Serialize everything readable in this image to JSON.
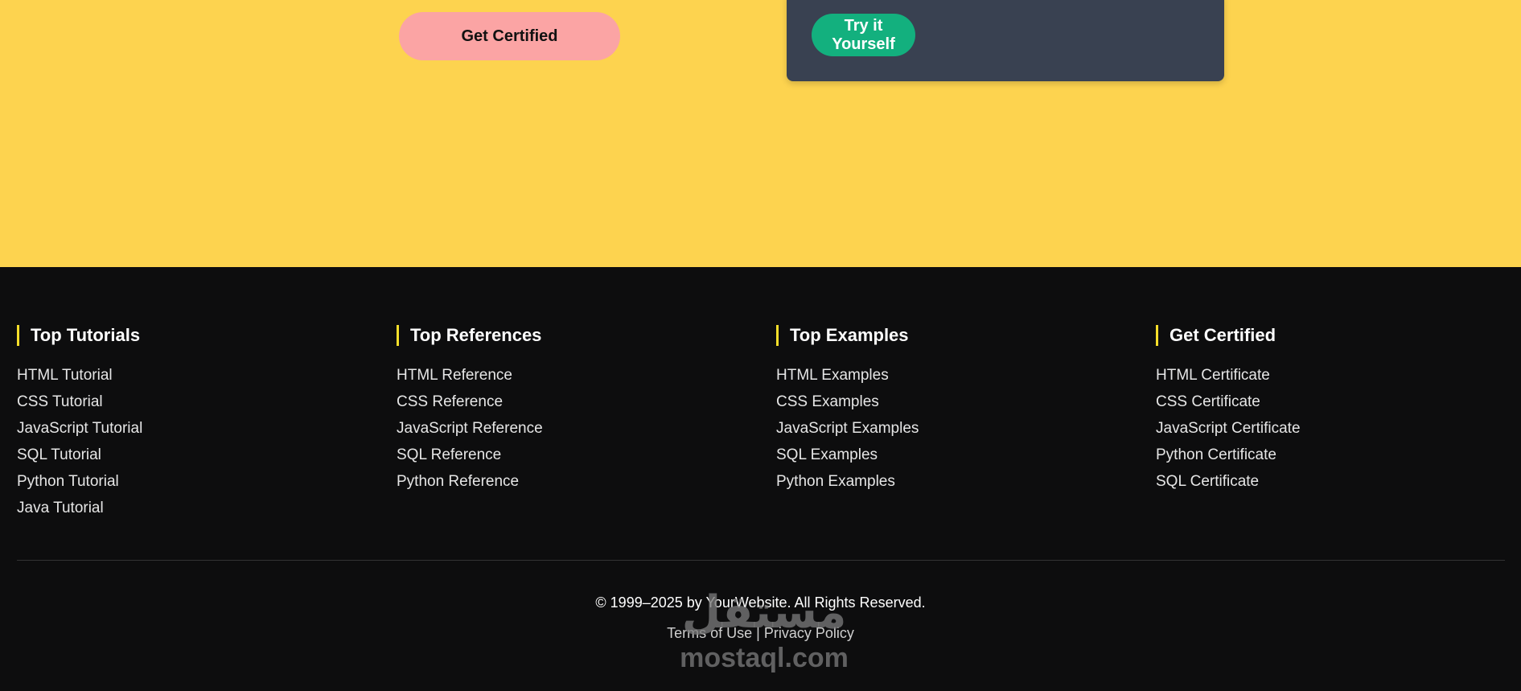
{
  "hero": {
    "background": "#fdd34f",
    "get_certified_label": "Get Certified",
    "try_it_label": "Try it Yourself"
  },
  "footer": {
    "columns": [
      {
        "title": "Top Tutorials",
        "links": [
          "HTML Tutorial",
          "CSS Tutorial",
          "JavaScript Tutorial",
          "SQL Tutorial",
          "Python Tutorial",
          "Java Tutorial"
        ]
      },
      {
        "title": "Top References",
        "links": [
          "HTML Reference",
          "CSS Reference",
          "JavaScript Reference",
          "SQL Reference",
          "Python Reference"
        ]
      },
      {
        "title": "Top Examples",
        "links": [
          "HTML Examples",
          "CSS Examples",
          "JavaScript Examples",
          "SQL Examples",
          "Python Examples"
        ]
      },
      {
        "title": "Get Certified",
        "links": [
          "HTML Certificate",
          "CSS Certificate",
          "JavaScript Certificate",
          "Python Certificate",
          "SQL Certificate"
        ]
      }
    ],
    "copyright": "© 1999–2025 by YourWebsite. All Rights Reserved.",
    "terms_label": "Terms of Use",
    "separator": "|",
    "privacy_label": "Privacy Policy"
  },
  "watermark": {
    "arabic": "مستقل",
    "latin": "mostaql.com"
  },
  "colors": {
    "footer_bg": "#0d0d0e",
    "accent_bar": "#f5de2a",
    "certify_button": "#fba4a4",
    "try_button": "#13b07e",
    "code_card": "#394151"
  }
}
